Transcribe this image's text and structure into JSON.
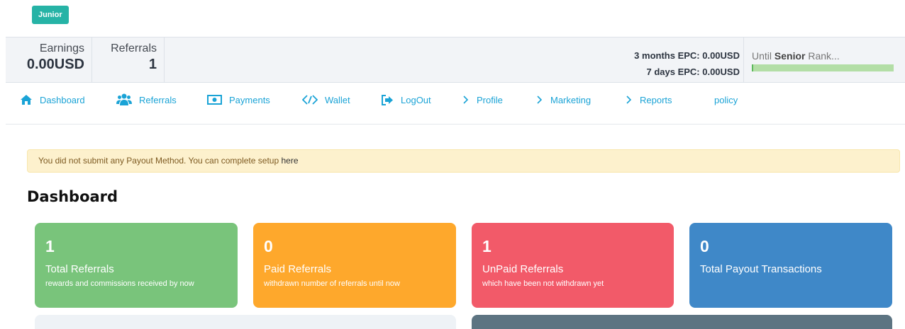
{
  "rank_badge": "Junior",
  "stats": {
    "earnings_label": "Earnings",
    "earnings_value": "0.00USD",
    "referrals_label": "Referrals",
    "referrals_value": "1"
  },
  "epc": {
    "three_months": "3 months EPC: 0.00USD",
    "seven_days": "7 days EPC: 0.00USD"
  },
  "rank_progress": {
    "prefix": "Until ",
    "rank": "Senior",
    "suffix": " Rank...",
    "progress": 0.01,
    "bar_color": "#b3dea6"
  },
  "nav": [
    {
      "label": "Dashboard",
      "icon": "home-icon"
    },
    {
      "label": "Referrals",
      "icon": "users-icon"
    },
    {
      "label": "Payments",
      "icon": "money-icon"
    },
    {
      "label": "Wallet",
      "icon": "wallet-icon"
    },
    {
      "label": "LogOut",
      "icon": "logout-icon"
    },
    {
      "label": "Profile",
      "icon": "chevron-right-icon"
    },
    {
      "label": "Marketing",
      "icon": "chevron-right-icon"
    },
    {
      "label": "Reports",
      "icon": "chevron-right-icon"
    },
    {
      "label": "policy",
      "icon": ""
    }
  ],
  "alert": {
    "text": "You did not submit any Payout Method. You can complete setup ",
    "link": "here"
  },
  "page_title": "Dashboard",
  "cards": [
    {
      "value": "1",
      "title": "Total Referrals",
      "subtitle": "rewards and commissions received by now",
      "color": "#79c47b"
    },
    {
      "value": "0",
      "title": "Paid Referrals",
      "subtitle": "withdrawn number of referrals until now",
      "color": "#fea82c"
    },
    {
      "value": "1",
      "title": "UnPaid Referrals",
      "subtitle": "which have been not withdrawn yet",
      "color": "#f25a69"
    },
    {
      "value": "0",
      "title": "Total Payout Transactions",
      "subtitle": "",
      "color": "#3f88c8"
    }
  ]
}
